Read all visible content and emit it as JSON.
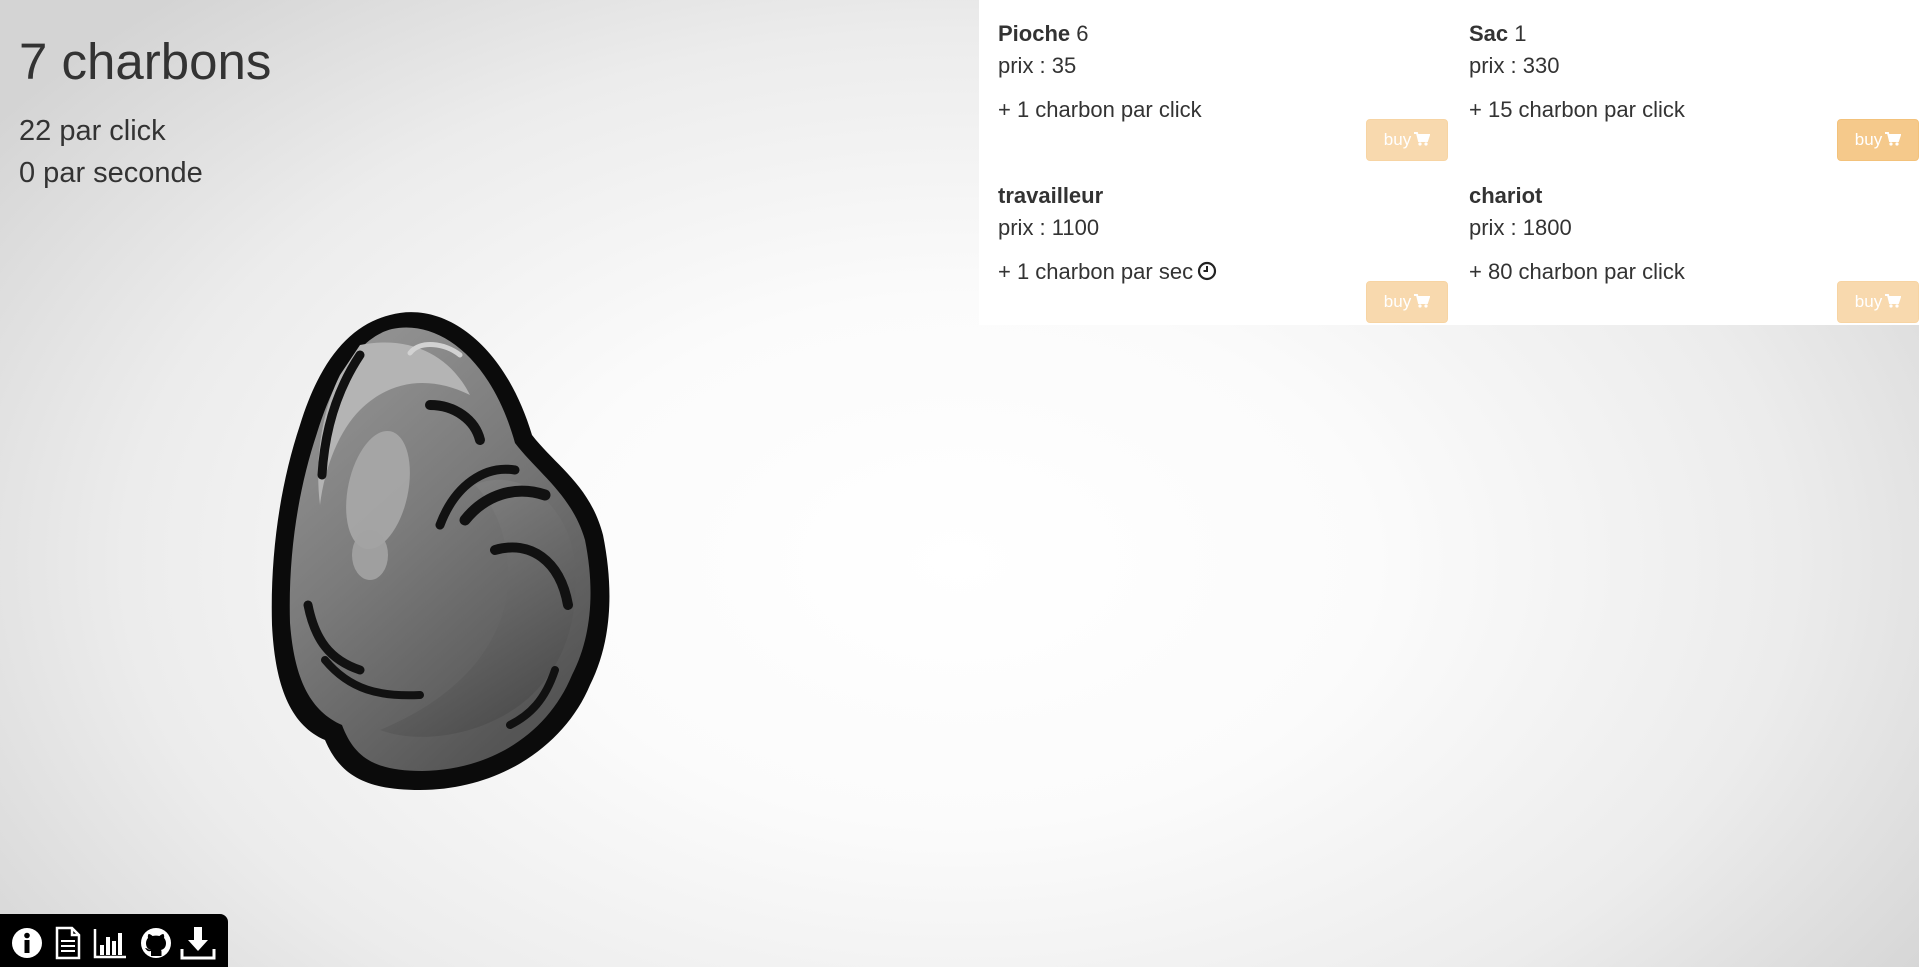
{
  "stats": {
    "counter": "7 charbons",
    "per_click": "22 par click",
    "per_second": "0 par seconde"
  },
  "shop": {
    "items": [
      {
        "name": "Pioche",
        "count": "6",
        "price": "prix : 35",
        "bonus": "+ 1 charbon par click",
        "button": "buy",
        "affordable": false
      },
      {
        "name": "Sac",
        "count": "1",
        "price": "prix : 330",
        "bonus": "+ 15 charbon par click",
        "button": "buy",
        "affordable": true
      },
      {
        "name": "travailleur",
        "count": "",
        "price": "prix : 1100",
        "bonus": "+ 1 charbon par sec",
        "button": "buy",
        "affordable": false
      },
      {
        "name": "chariot",
        "count": "",
        "price": "prix : 1800",
        "bonus": "+ 80 charbon par click",
        "button": "buy",
        "affordable": false
      }
    ]
  },
  "toolbar": {
    "icons": [
      "info-icon",
      "document-icon",
      "bar-chart-icon",
      "github-icon",
      "download-icon"
    ]
  },
  "colors": {
    "button": "#f0ad4e",
    "button_border": "#eea236",
    "text": "#333333",
    "toolbar": "#000000"
  }
}
